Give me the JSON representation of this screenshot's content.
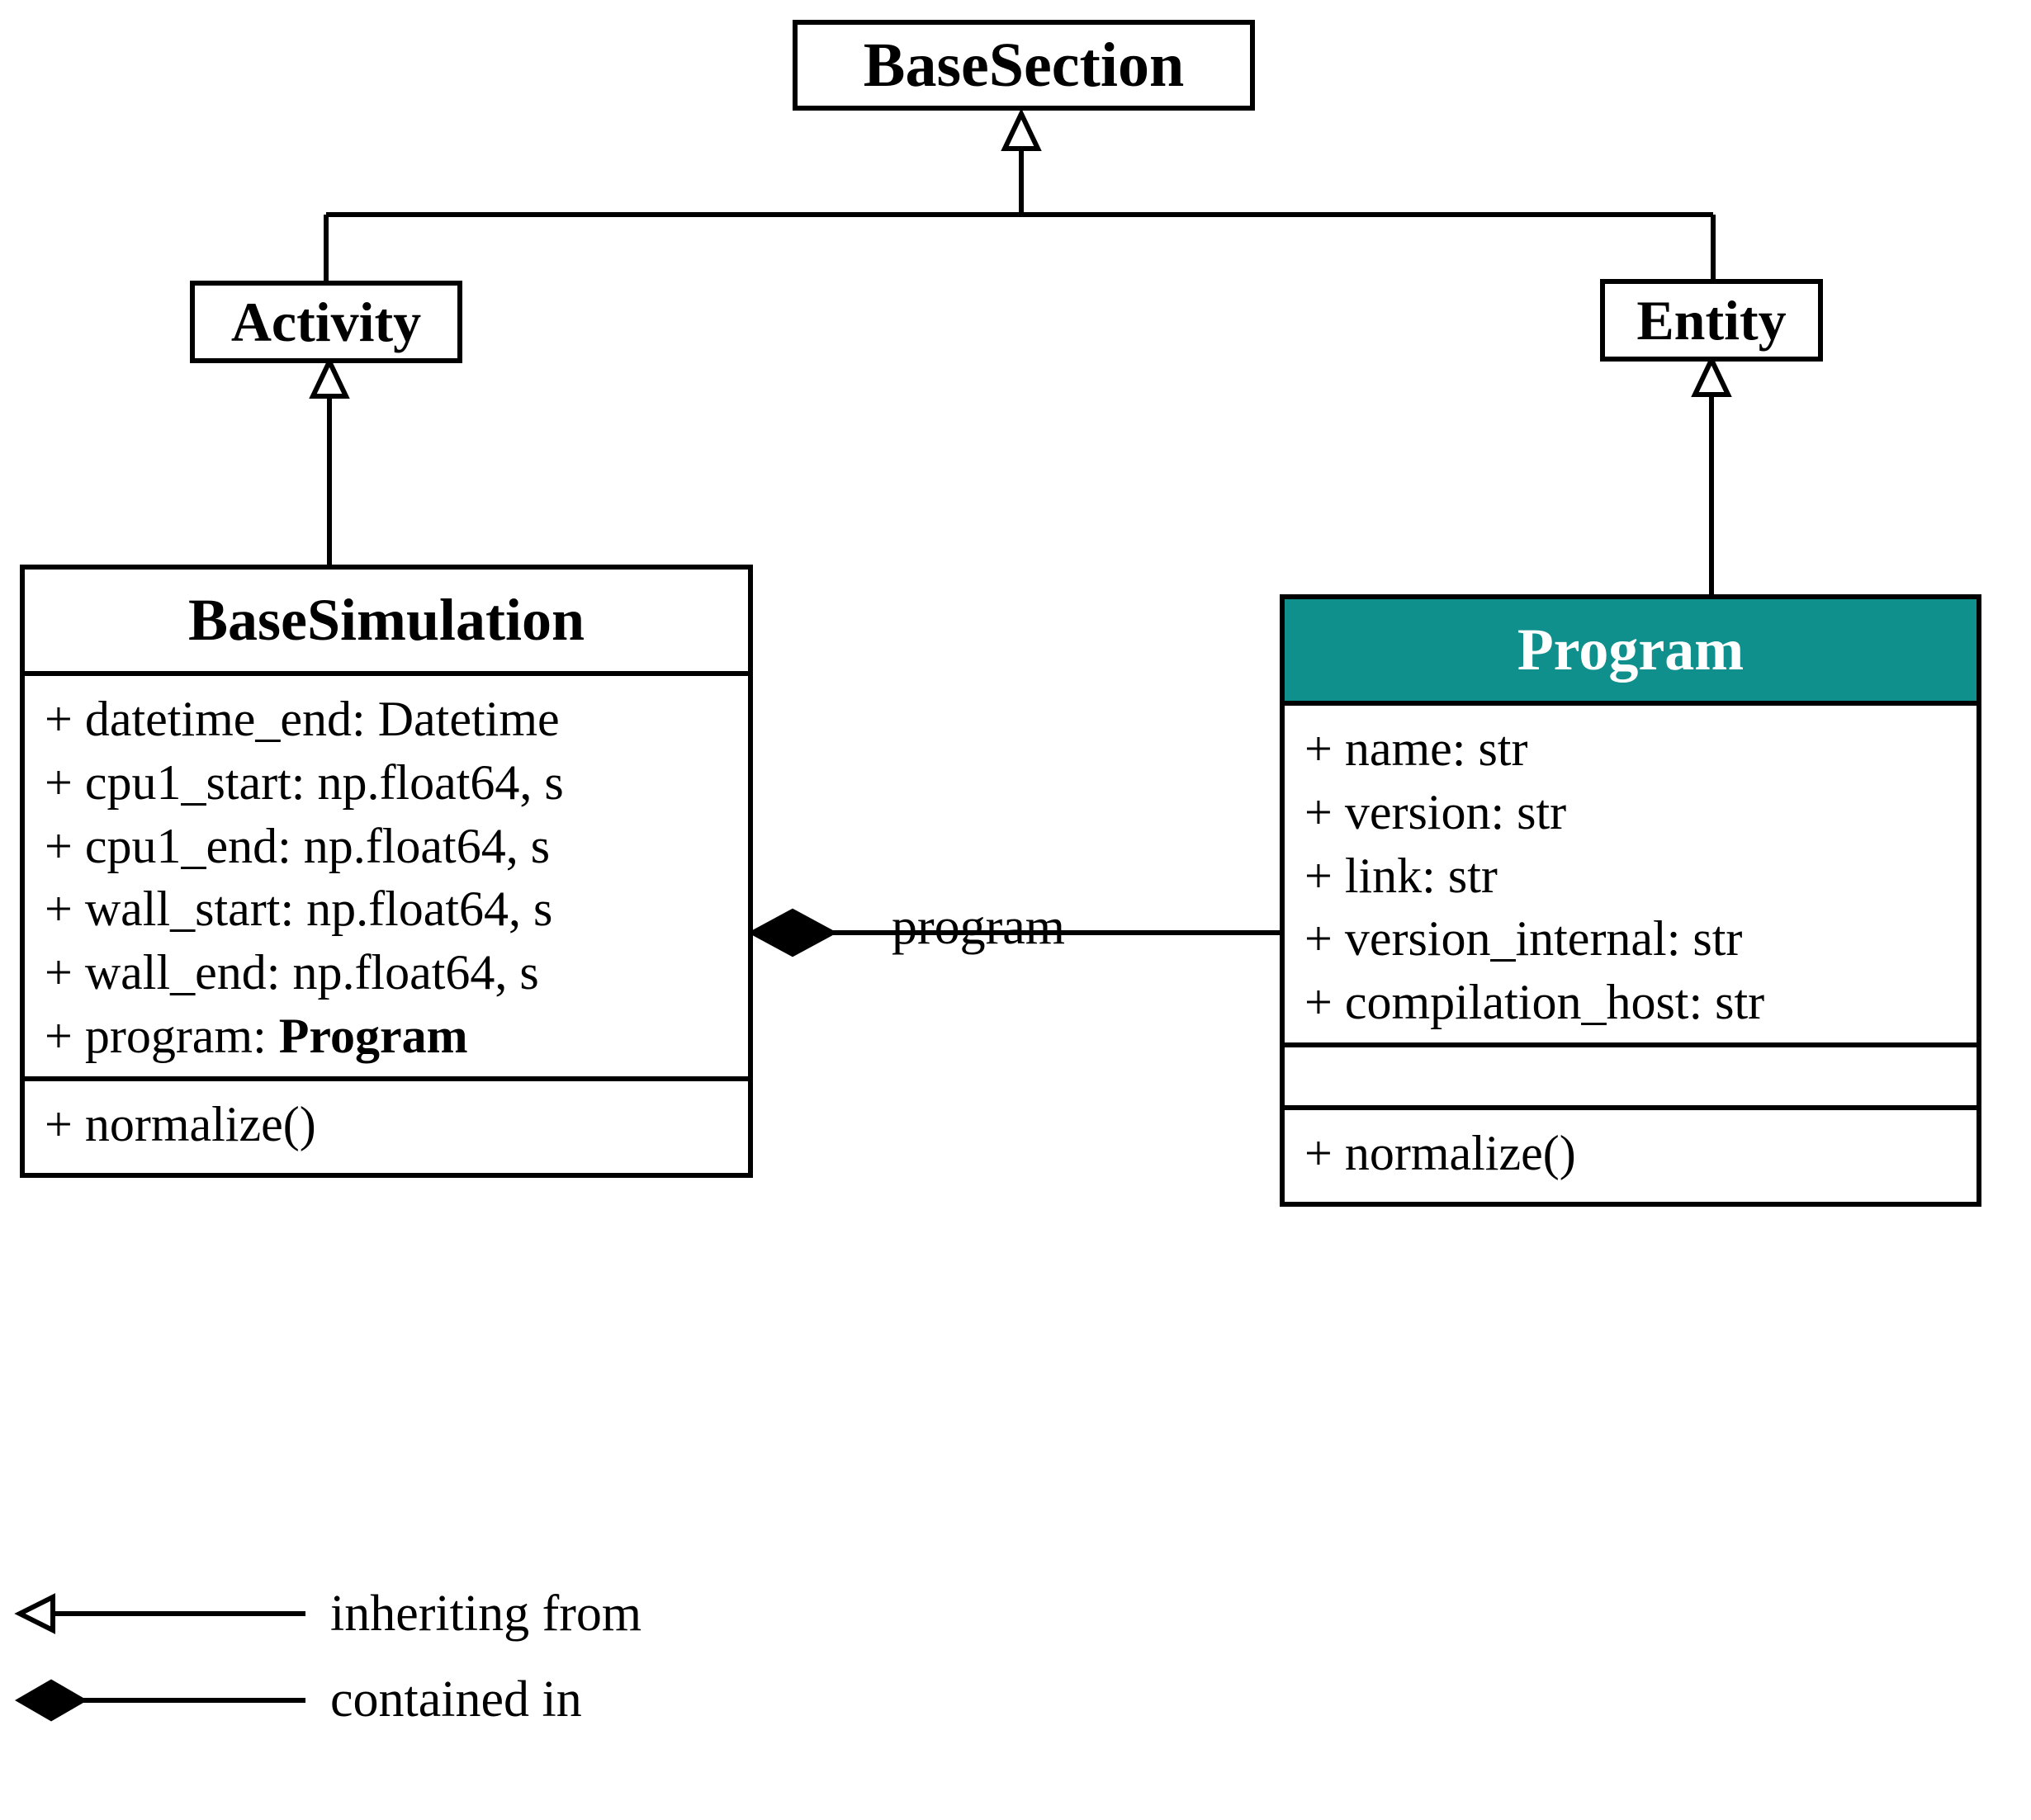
{
  "classes": {
    "base_section": {
      "name": "BaseSection"
    },
    "activity": {
      "name": "Activity"
    },
    "entity": {
      "name": "Entity"
    },
    "base_simulation": {
      "name": "BaseSimulation",
      "attrs": [
        "+ datetime_end: Datetime",
        "+ cpu1_start: np.float64, s",
        "+ cpu1_end: np.float64, s",
        "+ wall_start: np.float64, s",
        "+ wall_end: np.float64, s"
      ],
      "attr_program_prefix": "+ program: ",
      "attr_program_type": "Program",
      "methods": [
        "+ normalize()"
      ]
    },
    "program": {
      "name": "Program",
      "attrs": [
        "+ name: str",
        "+ version: str",
        "+ link: str",
        "+ version_internal: str",
        "+ compilation_host: str"
      ],
      "methods": [
        "+ normalize()"
      ]
    }
  },
  "association": {
    "program_label": "program"
  },
  "legend": {
    "inheriting": "inheriting from",
    "contained": "contained in"
  },
  "colors": {
    "teal": "#0f908c",
    "black": "#000000",
    "white": "#ffffff"
  }
}
